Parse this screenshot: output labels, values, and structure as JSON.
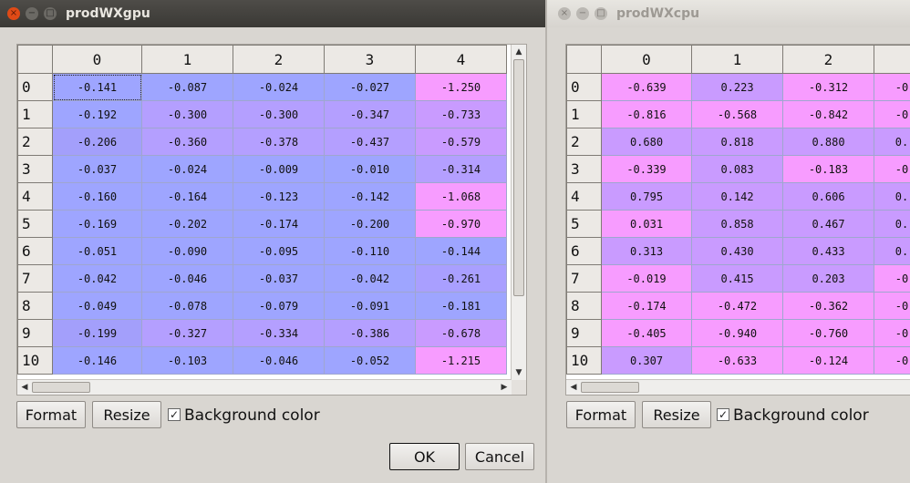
{
  "colors": {
    "blue_cell": "#9ea5ff",
    "purple_cell": "#c99bff",
    "pink_cell": "#f79cff",
    "window_bg": "#d9d6d1"
  },
  "windows": [
    {
      "id": "left",
      "title": "prodWXgpu",
      "titlebar_buttons": [
        "×",
        "−",
        "□"
      ],
      "columns": [
        "0",
        "1",
        "2",
        "3",
        "4"
      ],
      "rows": [
        {
          "label": "0",
          "cells": [
            {
              "v": "-0.141",
              "c": "#9ea5ff"
            },
            {
              "v": "-0.087",
              "c": "#9ea5ff"
            },
            {
              "v": "-0.024",
              "c": "#9ea5ff"
            },
            {
              "v": "-0.027",
              "c": "#9ea5ff"
            },
            {
              "v": "-1.250",
              "c": "#f79cff"
            }
          ]
        },
        {
          "label": "1",
          "cells": [
            {
              "v": "-0.192",
              "c": "#9ea5ff"
            },
            {
              "v": "-0.300",
              "c": "#b49fff"
            },
            {
              "v": "-0.300",
              "c": "#b49fff"
            },
            {
              "v": "-0.347",
              "c": "#b49fff"
            },
            {
              "v": "-0.733",
              "c": "#c99bff"
            }
          ]
        },
        {
          "label": "2",
          "cells": [
            {
              "v": "-0.206",
              "c": "#a39ffb"
            },
            {
              "v": "-0.360",
              "c": "#b49fff"
            },
            {
              "v": "-0.378",
              "c": "#b49fff"
            },
            {
              "v": "-0.437",
              "c": "#b49fff"
            },
            {
              "v": "-0.579",
              "c": "#c99bff"
            }
          ]
        },
        {
          "label": "3",
          "cells": [
            {
              "v": "-0.037",
              "c": "#9ea5ff"
            },
            {
              "v": "-0.024",
              "c": "#9ea5ff"
            },
            {
              "v": "-0.009",
              "c": "#9ea5ff"
            },
            {
              "v": "-0.010",
              "c": "#9ea5ff"
            },
            {
              "v": "-0.314",
              "c": "#b49fff"
            }
          ]
        },
        {
          "label": "4",
          "cells": [
            {
              "v": "-0.160",
              "c": "#9ea5ff"
            },
            {
              "v": "-0.164",
              "c": "#9ea5ff"
            },
            {
              "v": "-0.123",
              "c": "#9ea5ff"
            },
            {
              "v": "-0.142",
              "c": "#9ea5ff"
            },
            {
              "v": "-1.068",
              "c": "#f79cff"
            }
          ]
        },
        {
          "label": "5",
          "cells": [
            {
              "v": "-0.169",
              "c": "#9ea5ff"
            },
            {
              "v": "-0.202",
              "c": "#9ea5ff"
            },
            {
              "v": "-0.174",
              "c": "#9ea5ff"
            },
            {
              "v": "-0.200",
              "c": "#9ea5ff"
            },
            {
              "v": "-0.970",
              "c": "#f79cff"
            }
          ]
        },
        {
          "label": "6",
          "cells": [
            {
              "v": "-0.051",
              "c": "#9ea5ff"
            },
            {
              "v": "-0.090",
              "c": "#9ea5ff"
            },
            {
              "v": "-0.095",
              "c": "#9ea5ff"
            },
            {
              "v": "-0.110",
              "c": "#9ea5ff"
            },
            {
              "v": "-0.144",
              "c": "#9ea5ff"
            }
          ]
        },
        {
          "label": "7",
          "cells": [
            {
              "v": "-0.042",
              "c": "#9ea5ff"
            },
            {
              "v": "-0.046",
              "c": "#9ea5ff"
            },
            {
              "v": "-0.037",
              "c": "#9ea5ff"
            },
            {
              "v": "-0.042",
              "c": "#9ea5ff"
            },
            {
              "v": "-0.261",
              "c": "#a99fff"
            }
          ]
        },
        {
          "label": "8",
          "cells": [
            {
              "v": "-0.049",
              "c": "#9ea5ff"
            },
            {
              "v": "-0.078",
              "c": "#9ea5ff"
            },
            {
              "v": "-0.079",
              "c": "#9ea5ff"
            },
            {
              "v": "-0.091",
              "c": "#9ea5ff"
            },
            {
              "v": "-0.181",
              "c": "#9ea5ff"
            }
          ]
        },
        {
          "label": "9",
          "cells": [
            {
              "v": "-0.199",
              "c": "#a39ffb"
            },
            {
              "v": "-0.327",
              "c": "#b49fff"
            },
            {
              "v": "-0.334",
              "c": "#b49fff"
            },
            {
              "v": "-0.386",
              "c": "#b49fff"
            },
            {
              "v": "-0.678",
              "c": "#c99bff"
            }
          ]
        },
        {
          "label": "10",
          "cells": [
            {
              "v": "-0.146",
              "c": "#9ea5ff"
            },
            {
              "v": "-0.103",
              "c": "#9ea5ff"
            },
            {
              "v": "-0.046",
              "c": "#9ea5ff"
            },
            {
              "v": "-0.052",
              "c": "#9ea5ff"
            },
            {
              "v": "-1.215",
              "c": "#f79cff"
            }
          ]
        }
      ],
      "buttons": {
        "format": "Format",
        "resize": "Resize",
        "ok": "OK",
        "cancel": "Cancel"
      },
      "checkbox": {
        "label": "Background color",
        "checked": true,
        "mark": "✓"
      }
    },
    {
      "id": "right",
      "title": "prodWXcpu",
      "titlebar_buttons": [
        "×",
        "−",
        "□"
      ],
      "columns": [
        "0",
        "1",
        "2",
        ""
      ],
      "rows": [
        {
          "label": "0",
          "cells": [
            {
              "v": "-0.639",
              "c": "#f79cff"
            },
            {
              "v": "0.223",
              "c": "#c99bff"
            },
            {
              "v": "-0.312",
              "c": "#f79cff"
            },
            {
              "v": "-0",
              "c": "#f79cff"
            }
          ]
        },
        {
          "label": "1",
          "cells": [
            {
              "v": "-0.816",
              "c": "#f79cff"
            },
            {
              "v": "-0.568",
              "c": "#f79cff"
            },
            {
              "v": "-0.842",
              "c": "#f79cff"
            },
            {
              "v": "-0",
              "c": "#f79cff"
            }
          ]
        },
        {
          "label": "2",
          "cells": [
            {
              "v": "0.680",
              "c": "#c99bff"
            },
            {
              "v": "0.818",
              "c": "#c99bff"
            },
            {
              "v": "0.880",
              "c": "#c99bff"
            },
            {
              "v": "0.",
              "c": "#c99bff"
            }
          ]
        },
        {
          "label": "3",
          "cells": [
            {
              "v": "-0.339",
              "c": "#f79cff"
            },
            {
              "v": "0.083",
              "c": "#c99bff"
            },
            {
              "v": "-0.183",
              "c": "#f79cff"
            },
            {
              "v": "-0",
              "c": "#f79cff"
            }
          ]
        },
        {
          "label": "4",
          "cells": [
            {
              "v": "0.795",
              "c": "#c99bff"
            },
            {
              "v": "0.142",
              "c": "#c99bff"
            },
            {
              "v": "0.606",
              "c": "#c99bff"
            },
            {
              "v": "0.",
              "c": "#c99bff"
            }
          ]
        },
        {
          "label": "5",
          "cells": [
            {
              "v": "0.031",
              "c": "#f79cff"
            },
            {
              "v": "0.858",
              "c": "#c99bff"
            },
            {
              "v": "0.467",
              "c": "#c99bff"
            },
            {
              "v": "0.",
              "c": "#c99bff"
            }
          ]
        },
        {
          "label": "6",
          "cells": [
            {
              "v": "0.313",
              "c": "#c99bff"
            },
            {
              "v": "0.430",
              "c": "#c99bff"
            },
            {
              "v": "0.433",
              "c": "#c99bff"
            },
            {
              "v": "0.",
              "c": "#c99bff"
            }
          ]
        },
        {
          "label": "7",
          "cells": [
            {
              "v": "-0.019",
              "c": "#f79cff"
            },
            {
              "v": "0.415",
              "c": "#c99bff"
            },
            {
              "v": "0.203",
              "c": "#c99bff"
            },
            {
              "v": "-0",
              "c": "#f79cff"
            }
          ]
        },
        {
          "label": "8",
          "cells": [
            {
              "v": "-0.174",
              "c": "#f79cff"
            },
            {
              "v": "-0.472",
              "c": "#f79cff"
            },
            {
              "v": "-0.362",
              "c": "#f79cff"
            },
            {
              "v": "-0",
              "c": "#f79cff"
            }
          ]
        },
        {
          "label": "9",
          "cells": [
            {
              "v": "-0.405",
              "c": "#f79cff"
            },
            {
              "v": "-0.940",
              "c": "#f79cff"
            },
            {
              "v": "-0.760",
              "c": "#f79cff"
            },
            {
              "v": "-0",
              "c": "#f79cff"
            }
          ]
        },
        {
          "label": "10",
          "cells": [
            {
              "v": "0.307",
              "c": "#c99bff"
            },
            {
              "v": "-0.633",
              "c": "#f79cff"
            },
            {
              "v": "-0.124",
              "c": "#f79cff"
            },
            {
              "v": "-0",
              "c": "#f79cff"
            }
          ]
        }
      ],
      "buttons": {
        "format": "Format",
        "resize": "Resize"
      },
      "checkbox": {
        "label": "Background color",
        "checked": true,
        "mark": "✓"
      }
    }
  ]
}
